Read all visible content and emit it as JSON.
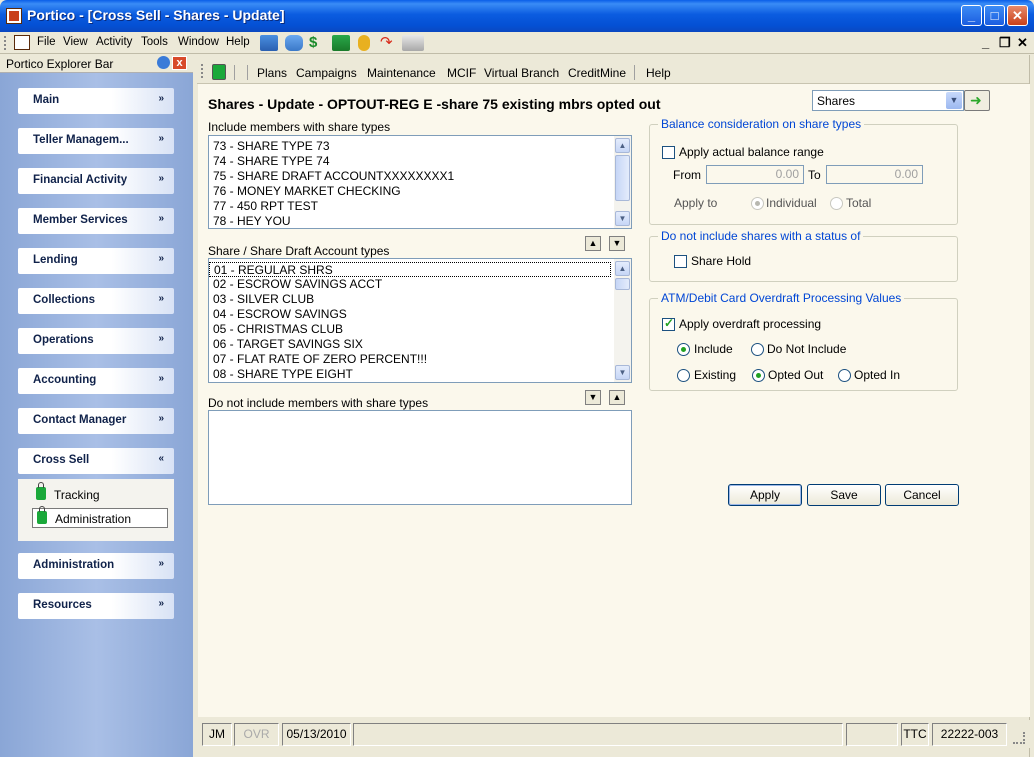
{
  "window": {
    "title": "Portico - [Cross Sell - Shares - Update]",
    "minimize": "_",
    "maximize": "□",
    "close": "✕",
    "mdi_minimize": "_",
    "mdi_restore": "❐",
    "mdi_close": "✕"
  },
  "menu": {
    "file": "File",
    "view": "View",
    "activity": "Activity",
    "tools": "Tools",
    "window": "Window",
    "help": "Help"
  },
  "explorer": {
    "title": "Portico Explorer Bar",
    "close": "x",
    "groups": {
      "main": "Main",
      "teller": "Teller Managem...",
      "financial": "Financial Activity",
      "member": "Member Services",
      "lending": "Lending",
      "collections": "Collections",
      "operations": "Operations",
      "accounting": "Accounting",
      "contact": "Contact Manager",
      "crosssell": "Cross Sell",
      "administration": "Administration",
      "resources": "Resources"
    },
    "expand_glyph": "»",
    "collapse_glyph": "«",
    "crosssell_items": {
      "tracking": "Tracking",
      "administration": "Administration"
    }
  },
  "module_toolbar": {
    "plans": "Plans",
    "campaigns": "Campaigns",
    "maintenance": "Maintenance",
    "mcif": "MCIF",
    "virtual_branch": "Virtual Branch",
    "creditmine": "CreditMine",
    "help": "Help"
  },
  "form": {
    "heading": "Shares - Update - OPTOUT-REG E -share 75 existing mbrs opted out",
    "type_select": "Shares",
    "include_label": "Include members with share types",
    "include_items": [
      "73 - SHARE TYPE 73",
      "74 - SHARE TYPE 74",
      "75 - SHARE DRAFT ACCOUNTXXXXXXXX1",
      "76 - MONEY MARKET CHECKING",
      "77 - 450 RPT TEST",
      "78 - HEY YOU"
    ],
    "account_types_label": "Share / Share Draft Account types",
    "account_types": [
      "01 - REGULAR SHRS",
      "02 - ESCROW SAVINGS ACCT",
      "03 - SILVER CLUB",
      "04 - ESCROW SAVINGS",
      "05 - CHRISTMAS CLUB",
      "06 - TARGET SAVINGS SIX",
      "07 - FLAT RATE OF ZERO PERCENT!!!",
      "08 - SHARE TYPE EIGHT"
    ],
    "exclude_label": "Do not include members with share types",
    "exclude_items": [],
    "balance": {
      "legend": "Balance consideration on share types",
      "apply_range": "Apply actual balance range",
      "apply_range_checked": false,
      "from_label": "From",
      "from_value": "0.00",
      "to_label": "To",
      "to_value": "0.00",
      "apply_to_label": "Apply to",
      "individual": "Individual",
      "total": "Total",
      "apply_to_selected": "Individual"
    },
    "status_exclude": {
      "legend": "Do not include shares with a status of",
      "share_hold": "Share Hold",
      "share_hold_checked": false
    },
    "atm": {
      "legend": "ATM/Debit Card Overdraft Processing Values",
      "apply_overdraft": "Apply overdraft processing",
      "apply_overdraft_checked": true,
      "include": "Include",
      "do_not_include": "Do Not Include",
      "include_selected": "Include",
      "existing": "Existing",
      "opted_out": "Opted Out",
      "opted_in": "Opted In",
      "status_selected": "Opted Out"
    },
    "buttons": {
      "apply": "Apply",
      "save": "Save",
      "cancel": "Cancel"
    }
  },
  "statusbar": {
    "user": "JM",
    "ovr": "OVR",
    "date": "05/13/2010",
    "ttc": "TTC",
    "id": "22222-003"
  }
}
